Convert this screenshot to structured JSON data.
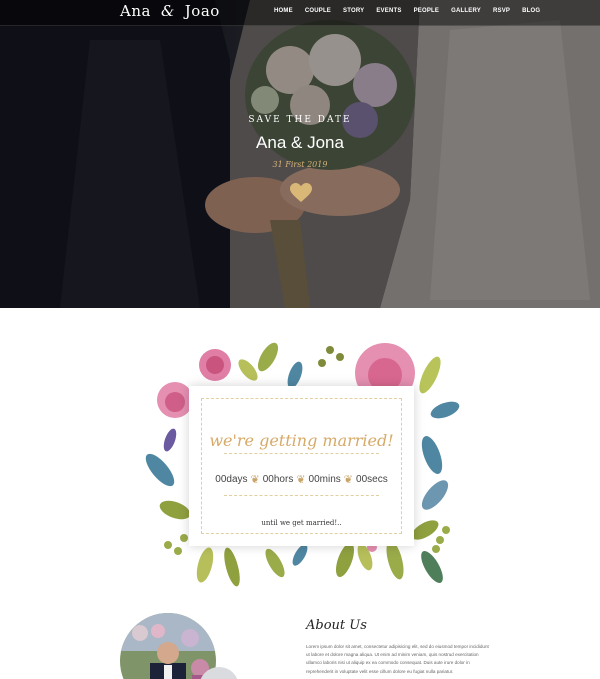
{
  "header": {
    "logo_left": "Ana",
    "logo_amp": "&",
    "logo_right": "Joao",
    "menu": [
      "HOME",
      "COUPLE",
      "STORY",
      "EVENTS",
      "PEOPLE",
      "GALLERY",
      "RSVP",
      "BLOG"
    ]
  },
  "hero": {
    "save_the_date": "SAVE THE DATE",
    "names": "Ana & Jona",
    "date": "31 First 2019",
    "accent_color": "#d5b178"
  },
  "countdown": {
    "title": "we're getting married!",
    "days": "00days",
    "hours": "00hors",
    "mins": "00mins",
    "secs": "00secs",
    "until": "until we get married!.."
  },
  "about": {
    "title": "About Us",
    "text": "Lorem ipsum dolor sit amet, consectetur adipisicing elit, sed do eiusmod tempor incididunt ut labore et dolore magna aliqua. Ut enim ad minim veniam, quis nostrud exercitation ullamco laboris nisi ut aliquip ex ea commodo consequat. Duis aute irure dolor in reprehenderit in voluptate velit esse cillum dolore eu fugiat nulla pariatur."
  },
  "icons": {
    "heart": "heart-icon",
    "sprig": "sprig-icon"
  }
}
